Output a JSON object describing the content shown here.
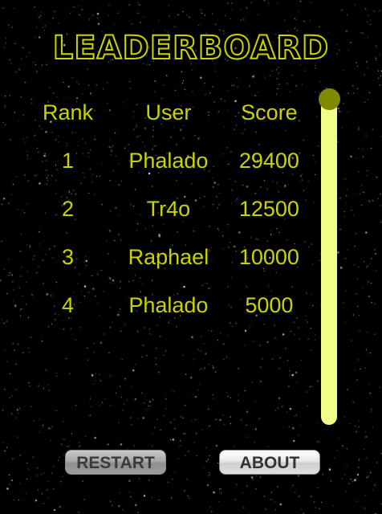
{
  "title": "LEADERBOARD",
  "columns": {
    "rank": "Rank",
    "user": "User",
    "score": "Score"
  },
  "entries": [
    {
      "rank": "1",
      "user": "Phalado",
      "score": "29400"
    },
    {
      "rank": "2",
      "user": "Tr4o",
      "score": "12500"
    },
    {
      "rank": "3",
      "user": "Raphael",
      "score": "10000"
    },
    {
      "rank": "4",
      "user": "Phalado",
      "score": "5000"
    }
  ],
  "buttons": {
    "restart": "RESTART",
    "about": "ABOUT"
  },
  "colors": {
    "accent": "#c8d400",
    "scrollbar_track": "#f0ff88",
    "scrollbar_thumb": "#7f8a00",
    "background": "#000000"
  }
}
